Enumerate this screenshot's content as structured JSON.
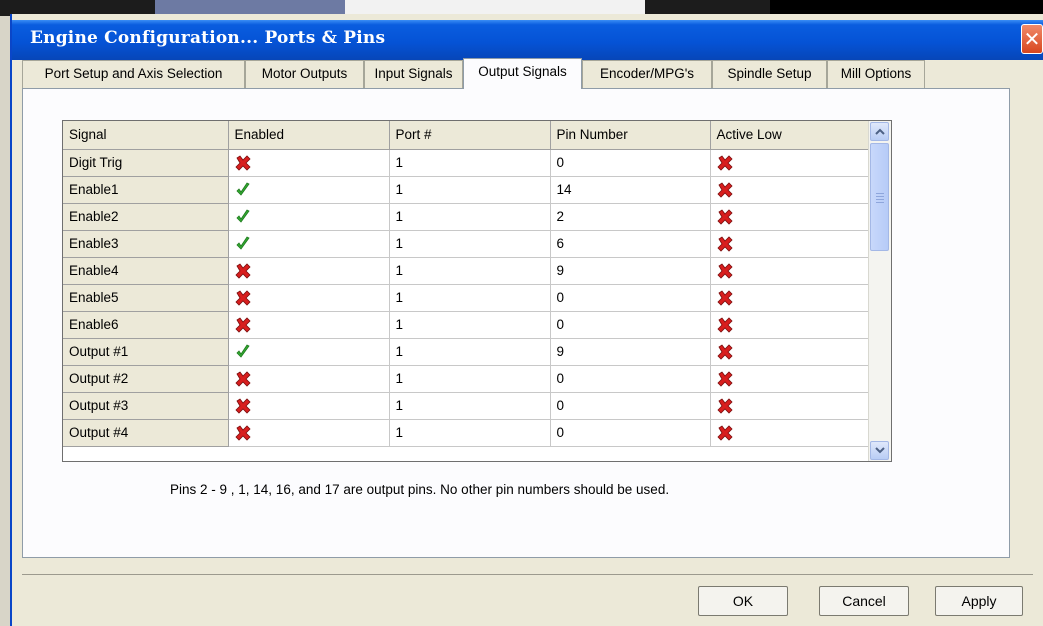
{
  "window": {
    "title": "Engine Configuration... Ports & Pins",
    "close_glyph": "✕"
  },
  "tabs": [
    {
      "label": "Port Setup and Axis Selection",
      "active": false
    },
    {
      "label": "Motor Outputs",
      "active": false
    },
    {
      "label": "Input Signals",
      "active": false
    },
    {
      "label": "Output Signals",
      "active": true
    },
    {
      "label": "Encoder/MPG's",
      "active": false
    },
    {
      "label": "Spindle Setup",
      "active": false
    },
    {
      "label": "Mill Options",
      "active": false
    }
  ],
  "table": {
    "columns": [
      "Signal",
      "Enabled",
      "Port #",
      "Pin Number",
      "Active Low"
    ],
    "rows": [
      {
        "signal": "Digit  Trig",
        "enabled": false,
        "port": "1",
        "pin": "0",
        "active_low": false
      },
      {
        "signal": "Enable1",
        "enabled": true,
        "port": "1",
        "pin": "14",
        "active_low": false
      },
      {
        "signal": "Enable2",
        "enabled": true,
        "port": "1",
        "pin": "2",
        "active_low": false
      },
      {
        "signal": "Enable3",
        "enabled": true,
        "port": "1",
        "pin": "6",
        "active_low": false
      },
      {
        "signal": "Enable4",
        "enabled": false,
        "port": "1",
        "pin": "9",
        "active_low": false
      },
      {
        "signal": "Enable5",
        "enabled": false,
        "port": "1",
        "pin": "0",
        "active_low": false
      },
      {
        "signal": "Enable6",
        "enabled": false,
        "port": "1",
        "pin": "0",
        "active_low": false
      },
      {
        "signal": "Output #1",
        "enabled": true,
        "port": "1",
        "pin": "9",
        "active_low": false
      },
      {
        "signal": "Output #2",
        "enabled": false,
        "port": "1",
        "pin": "0",
        "active_low": false
      },
      {
        "signal": "Output #3",
        "enabled": false,
        "port": "1",
        "pin": "0",
        "active_low": false
      },
      {
        "signal": "Output #4",
        "enabled": false,
        "port": "1",
        "pin": "0",
        "active_low": false
      }
    ]
  },
  "note": "Pins 2 - 9 , 1, 14, 16, and 17 are output pins. No  other pin numbers should be used.",
  "buttons": {
    "ok": "OK",
    "cancel": "Cancel",
    "apply": "Apply"
  },
  "colors": {
    "title_bar": "#0553d6",
    "check": "#33a832",
    "cross": "#d81e1e"
  },
  "icons": {
    "enabled_true": "green-check-icon",
    "enabled_false": "red-x-icon"
  }
}
